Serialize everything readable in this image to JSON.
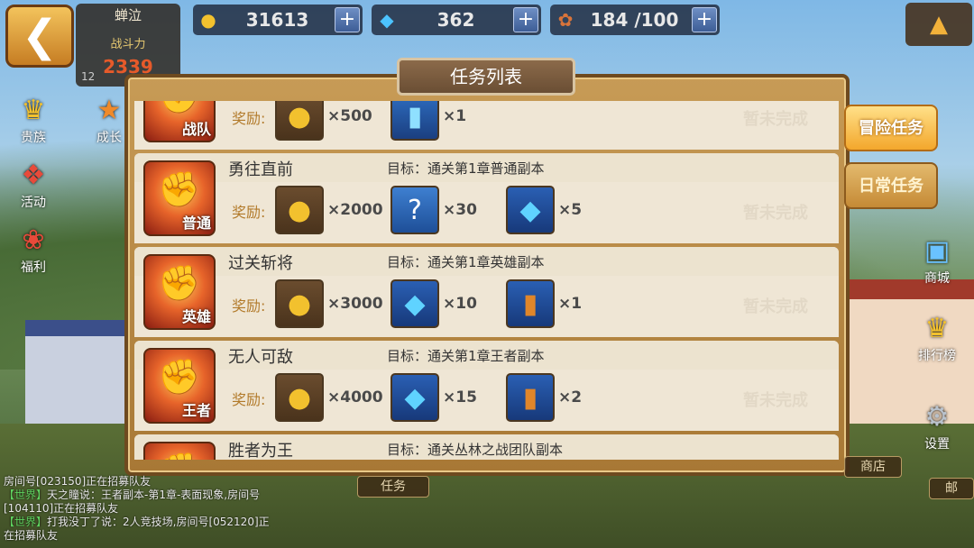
{
  "header": {
    "back_icon": "chevron-left-icon",
    "player_name": "蝉泣",
    "power_label": "战斗力",
    "power_value": "2339",
    "level": "12",
    "gold": "31613",
    "gems": "362",
    "stamina": "184 /100",
    "collapse_icon": "triangle-up-icon"
  },
  "side_left": [
    "贵族",
    "成长",
    "活动",
    "福利"
  ],
  "side_right": [
    "商城",
    "排行榜",
    "设置"
  ],
  "panel": {
    "title": "任务列表",
    "tabs": [
      {
        "label": "冒险任务",
        "active": true
      },
      {
        "label": "日常任务",
        "active": false
      }
    ],
    "reward_label": "奖励:",
    "quests": [
      {
        "name": "",
        "goal": "",
        "badge": "战队",
        "rewards": [
          {
            "type": "coin",
            "count": "×500"
          },
          {
            "type": "book",
            "count": "×1"
          }
        ],
        "status": "暂未完成"
      },
      {
        "name": "勇往直前",
        "goal": "目标：通关第1章普通副本",
        "badge": "普通",
        "rewards": [
          {
            "type": "coin",
            "count": "×2000"
          },
          {
            "type": "mystery",
            "count": "×30"
          },
          {
            "type": "gem",
            "count": "×5"
          }
        ],
        "status": "暂未完成"
      },
      {
        "name": "过关斩将",
        "goal": "目标：通关第1章英雄副本",
        "badge": "英雄",
        "rewards": [
          {
            "type": "coin",
            "count": "×3000"
          },
          {
            "type": "gem",
            "count": "×10"
          },
          {
            "type": "card",
            "count": "×1"
          }
        ],
        "status": "暂未完成"
      },
      {
        "name": "无人可敌",
        "goal": "目标：通关第1章王者副本",
        "badge": "王者",
        "rewards": [
          {
            "type": "coin",
            "count": "×4000"
          },
          {
            "type": "gem",
            "count": "×15"
          },
          {
            "type": "card",
            "count": "×2"
          }
        ],
        "status": "暂未完成"
      },
      {
        "name": "胜者为王",
        "goal": "目标：通关丛林之战团队副本",
        "badge": "",
        "rewards": [],
        "status": ""
      }
    ]
  },
  "bottom": {
    "task_tab": "任务",
    "shop_tab": "商店",
    "mail_tab": "邮"
  },
  "chat": [
    {
      "channel": "",
      "text": "房间号[023150]正在招募队友"
    },
    {
      "channel": "【世界】",
      "text": "天之瞳说：王者副本-第1章-表面现象,房间号[104110]正在招募队友"
    },
    {
      "channel": "【世界】",
      "text": "打我没丁了说：2人竞技场,房间号[052120]正在招募队友"
    }
  ]
}
